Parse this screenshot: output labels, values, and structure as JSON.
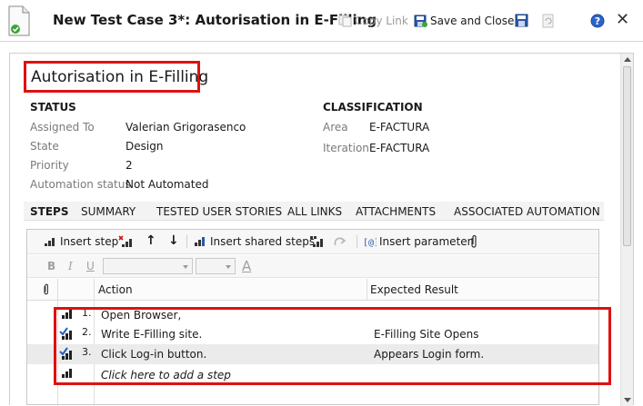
{
  "window": {
    "title": "New Test Case 3*: Autorisation in E-Filling",
    "copy_link": "Copy Link",
    "save_and_close": "Save and Close",
    "close_glyph": "✕",
    "help_glyph": "?"
  },
  "test_case": {
    "title": "Autorisation in E-Filling"
  },
  "status": {
    "heading": "STATUS",
    "fields": [
      {
        "label": "Assigned To",
        "value": "Valerian Grigorasenco"
      },
      {
        "label": "State",
        "value": "Design"
      },
      {
        "label": "Priority",
        "value": "2"
      },
      {
        "label": "Automation status",
        "value": "Not Automated"
      }
    ]
  },
  "classification": {
    "heading": "CLASSIFICATION",
    "fields": [
      {
        "label": "Area",
        "value": "E-FACTURA"
      },
      {
        "label": "Iteration",
        "value": "E-FACTURA"
      }
    ]
  },
  "tabs": [
    {
      "label": "STEPS",
      "active": true
    },
    {
      "label": "SUMMARY",
      "active": false
    },
    {
      "label": "TESTED USER STORIES",
      "active": false
    },
    {
      "label": "ALL LINKS",
      "active": false
    },
    {
      "label": "ATTACHMENTS",
      "active": false
    },
    {
      "label": "ASSOCIATED AUTOMATION",
      "active": false
    }
  ],
  "toolbar": {
    "insert_step": "Insert step",
    "insert_shared_steps": "Insert shared steps",
    "insert_parameter": "Insert parameter",
    "move_up_glyph": "↑",
    "move_down_glyph": "↓",
    "bold": "B",
    "italic": "I",
    "underline": "U",
    "font_color_glyph": "A"
  },
  "grid": {
    "col_action": "Action",
    "col_expected": "Expected Result",
    "rows": [
      {
        "num": "1.",
        "action": "Open Browser,",
        "expected": "",
        "validated": false
      },
      {
        "num": "2.",
        "action": "Write E-Filling site.",
        "expected": "E-Filling Site Opens",
        "validated": true
      },
      {
        "num": "3.",
        "action": "Click Log-in button.",
        "expected": "Appears Login form.",
        "validated": true
      }
    ],
    "add_step": "Click here to add a step"
  },
  "colors": {
    "highlight": "#e01010",
    "accent_blue": "#1f5fbf"
  }
}
